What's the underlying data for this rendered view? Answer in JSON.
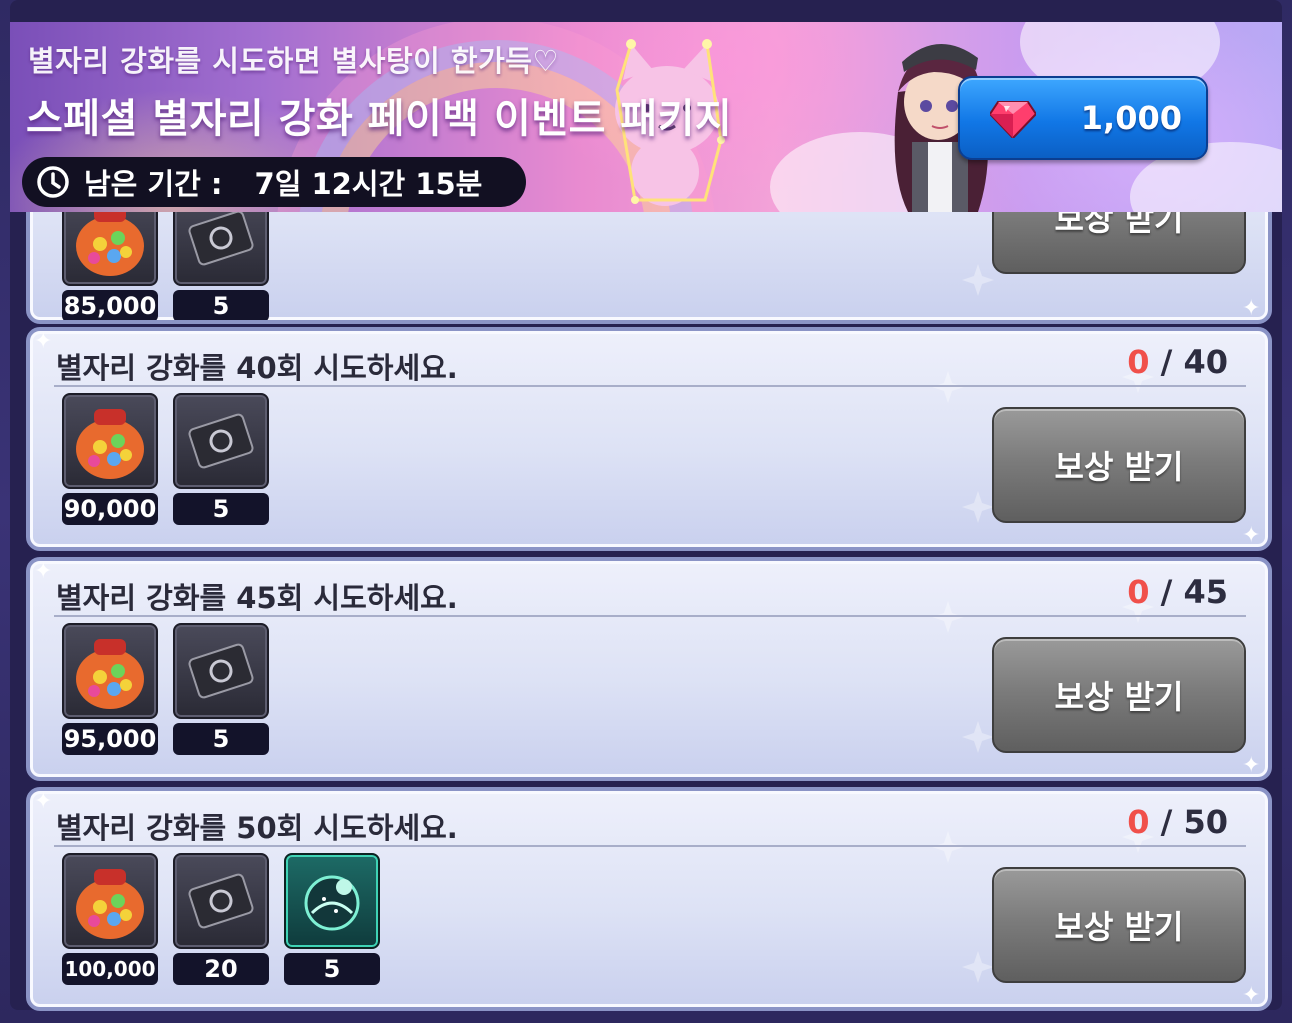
{
  "banner": {
    "subtitle": "별자리 강화를 시도하면 별사탕이 한가득♡",
    "title": "스페셜 별자리 강화 페이백 이벤트 패키지",
    "remaining_label": "남은 기간 :",
    "remaining_value": "7일 12시간 15분",
    "price": "1,000",
    "price_icon": "ruby-gem-icon"
  },
  "missions": [
    {
      "title": "",
      "progress_current": "",
      "progress_total": "",
      "claim_label": "보상 받기",
      "rewards": [
        {
          "icon": "candy-jar-icon",
          "qty": "85,000"
        },
        {
          "icon": "ticket-card-icon",
          "qty": "5"
        }
      ]
    },
    {
      "title": "별자리 강화를 40회 시도하세요.",
      "progress_current": "0",
      "progress_total": "40",
      "claim_label": "보상 받기",
      "rewards": [
        {
          "icon": "candy-jar-icon",
          "qty": "90,000"
        },
        {
          "icon": "ticket-card-icon",
          "qty": "5"
        }
      ]
    },
    {
      "title": "별자리 강화를 45회 시도하세요.",
      "progress_current": "0",
      "progress_total": "45",
      "claim_label": "보상 받기",
      "rewards": [
        {
          "icon": "candy-jar-icon",
          "qty": "95,000"
        },
        {
          "icon": "ticket-card-icon",
          "qty": "5"
        }
      ]
    },
    {
      "title": "별자리 강화를 50회 시도하세요.",
      "progress_current": "0",
      "progress_total": "50",
      "claim_label": "보상 받기",
      "rewards": [
        {
          "icon": "candy-jar-icon",
          "qty": "100,000"
        },
        {
          "icon": "ticket-card-icon",
          "qty": "20"
        },
        {
          "icon": "constellation-orb-icon",
          "qty": "5"
        }
      ]
    }
  ],
  "colors": {
    "progress_current": "#f0504a",
    "price_button": "#1177e6",
    "claim_button": "#7c7c7c"
  }
}
